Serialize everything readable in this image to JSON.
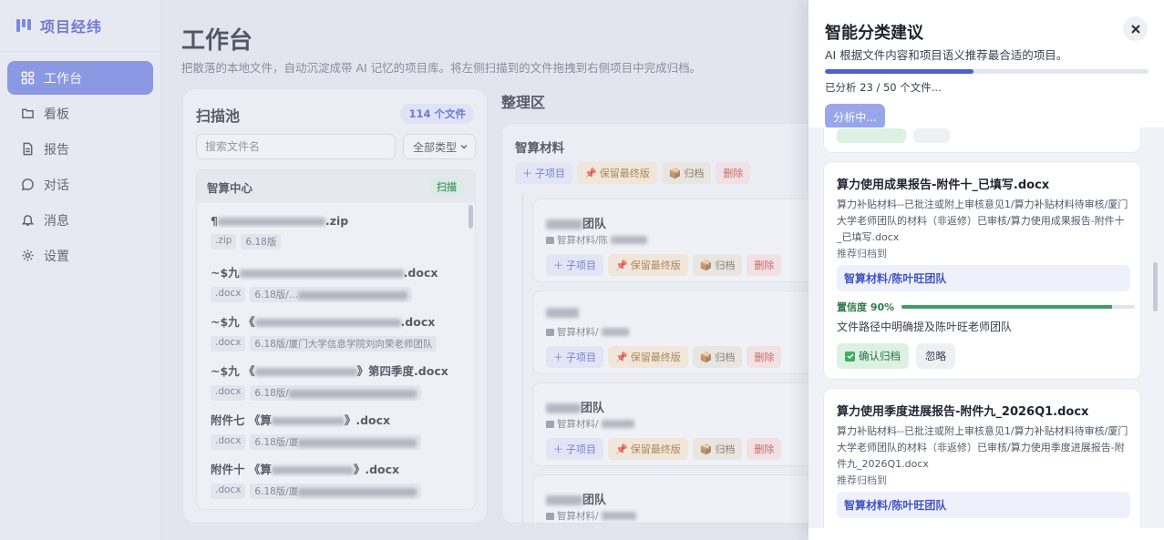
{
  "brand": {
    "title": "项目经纬"
  },
  "sidebar": {
    "items": [
      {
        "label": "工作台",
        "icon": "grid-icon"
      },
      {
        "label": "看板",
        "icon": "kanban-icon"
      },
      {
        "label": "报告",
        "icon": "report-icon"
      },
      {
        "label": "对话",
        "icon": "chat-icon"
      },
      {
        "label": "消息",
        "icon": "bell-icon"
      },
      {
        "label": "设置",
        "icon": "gear-icon"
      }
    ]
  },
  "main": {
    "title": "工作台",
    "subtitle": "把散落的本地文件，自动沉淀成带 AI 记忆的项目库。将左侧扫描到的文件拖拽到右侧项目中完成归档。"
  },
  "scan": {
    "title": "扫描池",
    "count_badge": "114 个文件",
    "search_placeholder": "搜索文件名",
    "type_filter": "全部类型",
    "group_title": "智算中心",
    "group_action": "扫描",
    "files": [
      {
        "name_prefix": "¶",
        "name_suffix": ".zip",
        "tags": [
          ".zip",
          "6.18版"
        ]
      },
      {
        "name_prefix": "~$九",
        "name_suffix": ".docx",
        "tags": [
          ".docx",
          "6.18版/..."
        ]
      },
      {
        "name_prefix": "~$九 《",
        "name_suffix": ".docx",
        "tags": [
          ".docx",
          "6.18版/厦门大学信息学院刘向荣老师团队"
        ]
      },
      {
        "name_prefix": "~$九 《",
        "name_suffix": "》第四季度.docx",
        "tags": [
          ".docx",
          "6.18版/"
        ]
      },
      {
        "name_prefix": "附件七 《算",
        "name_suffix": "》.docx",
        "tags": [
          ".docx",
          "6.18版/厦"
        ]
      },
      {
        "name_prefix": "附件十 《算",
        "name_suffix": "》.docx",
        "tags": [
          ".docx",
          "6.18版/厦"
        ]
      }
    ]
  },
  "organize": {
    "title": "整理区",
    "project": {
      "title": "智算材料",
      "buttons": {
        "sub": "子项目",
        "keep": "保留最终版",
        "archive": "归档",
        "delete": "删除"
      }
    },
    "teams": [
      {
        "name_suffix": "团队",
        "path": "智算材料/陈"
      },
      {
        "name_suffix": "",
        "path": "智算材料/"
      },
      {
        "name_suffix": "团队",
        "path": "智算材料/"
      },
      {
        "name_suffix": "团队",
        "path": "智算材料/"
      }
    ],
    "team_buttons": {
      "sub": "子项目",
      "keep": "保留最终版",
      "archive": "归档",
      "delete": "删除"
    }
  },
  "drawer": {
    "title": "智能分类建议",
    "description": "AI 根据文件内容和项目语义推荐最合适的项目。",
    "progress_text": "已分析 23 / 50 个文件...",
    "progress_done": 23,
    "progress_total": 50,
    "analyze_button": "分析中...",
    "suggestions": [
      {
        "title": "算力使用成果报告-附件十_已填写.docx",
        "path": "算力补贴材料--已批注或附上审核意见1/算力补贴材料待审核/厦门大学老师团队的材料（非返修）已审核/算力使用成果报告-附件十_已填写.docx",
        "recommend_label": "推荐归档到",
        "target": "智算材料/陈叶旺团队",
        "confidence_label": "置信度 90%",
        "confidence": 0.9,
        "reason": "文件路径中明确提及陈叶旺老师团队",
        "confirm": "确认归档",
        "ignore": "忽略"
      },
      {
        "title": "算力使用季度进展报告-附件九_2026Q1.docx",
        "path": "算力补贴材料--已批注或附上审核意见1/算力补贴材料待审核/厦门大学老师团队的材料（非返修）已审核/算力使用季度进展报告-附件九_2026Q1.docx",
        "recommend_label": "推荐归档到",
        "target": "智算材料/陈叶旺团队"
      }
    ]
  },
  "colors": {
    "accent": "#5a6bd6",
    "success": "#3f9d66",
    "danger": "#c0443f"
  }
}
